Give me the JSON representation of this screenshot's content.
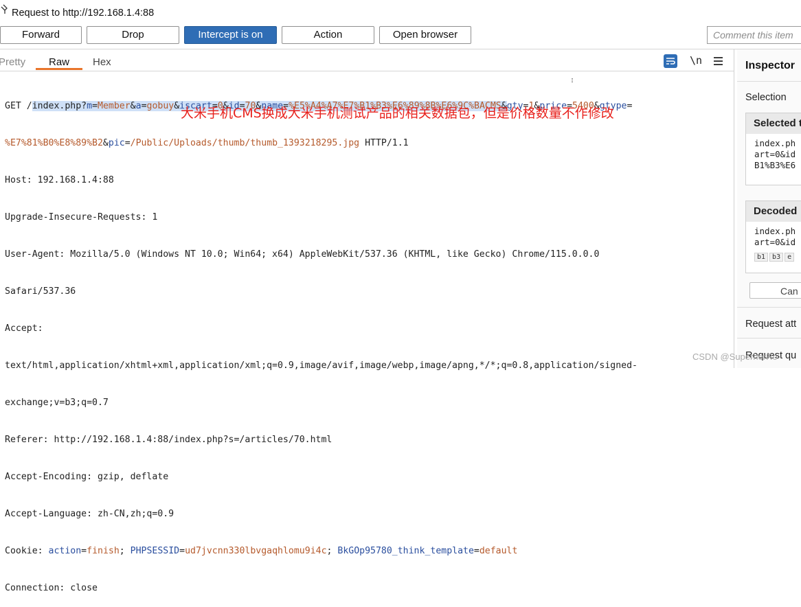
{
  "header": {
    "title": "Request to http://192.168.1.4:88"
  },
  "toolbar": {
    "forward": "Forward",
    "drop": "Drop",
    "intercept": "Intercept is on",
    "action": "Action",
    "open_browser": "Open browser",
    "comment_placeholder": "Comment this item"
  },
  "tabs": {
    "pretty": "Pretty",
    "raw": "Raw",
    "hex": "Hex",
    "active": "Raw",
    "newline_toggle": "\\n"
  },
  "request": {
    "l1_method": "GET /",
    "l1_path": "index.php?",
    "l1_m_k": "m",
    "l1_m_v": "Member",
    "l1_a_k": "a",
    "l1_a_v": "gobuy",
    "l1_iscart_k": "iscart",
    "l1_iscart_v": "0",
    "l1_id_k": "id",
    "l1_id_v": "70",
    "l1_name_k": "name",
    "l1_name_v": "%E5%A4%A7%E7%B1%B3%E6%89%8B%E6%9C%BACMS",
    "l1_qty_k": "gty",
    "l1_qty_v": "1",
    "l1_price_k": "price",
    "l1_price_v": "5400",
    "l1_gtype_k": "gtype",
    "l2_gtype_v": "%E7%81%B0%E8%89%B2",
    "l2_pic_k": "pic",
    "l2_pic_v": "/Public/Uploads/thumb/thumb_1393218295.jpg",
    "l2_proto": " HTTP/1.1",
    "host": "Host: 192.168.1.4:88",
    "upgrade": "Upgrade-Insecure-Requests: 1",
    "ua1": "User-Agent: Mozilla/5.0 (Windows NT 10.0; Win64; x64) AppleWebKit/537.36 (KHTML, like Gecko) Chrome/115.0.0.0",
    "ua2": "Safari/537.36",
    "accept_h": "Accept:",
    "accept1": "text/html,application/xhtml+xml,application/xml;q=0.9,image/avif,image/webp,image/apng,*/*;q=0.8,application/signed-",
    "accept2": "exchange;v=b3;q=0.7",
    "referer": "Referer: http://192.168.1.4:88/index.php?s=/articles/70.html",
    "encoding": "Accept-Encoding: gzip, deflate",
    "language": "Accept-Language: zh-CN,zh;q=0.9",
    "cookie_h": "Cookie: ",
    "c1_k": "action",
    "c1_v": "finish",
    "c2_k": "PHPSESSID",
    "c2_v": "ud7jvcnn330lbvgaqhlomu9i4c",
    "c3_k": "BkGOp95780_think_template",
    "c3_v": "default",
    "connection": "Connection: close"
  },
  "annotation": "大米手机CMS换成大米手机测试产品的相关数据包，但是价格数量不作修改",
  "inspector": {
    "title": "Inspector",
    "selection": "Selection",
    "selected_text_head": "Selected t",
    "selected_text_body": "index.ph\nart=0&id\nB1%B3%E6",
    "decoded_head": "Decoded",
    "decoded_body": "index.ph\nart=0&id",
    "chips": [
      "b1",
      "b3",
      "e"
    ],
    "cancel": "Can",
    "request_attributes": "Request att",
    "request_query": "Request qu"
  },
  "watermark": "CSDN @SuperherRo",
  "colors": {
    "intercept_on": "#2f6db5",
    "tab_accent": "#e8742a",
    "param_key": "#2a4e9e",
    "param_value": "#b55a2c",
    "annotation": "#e8211c"
  }
}
